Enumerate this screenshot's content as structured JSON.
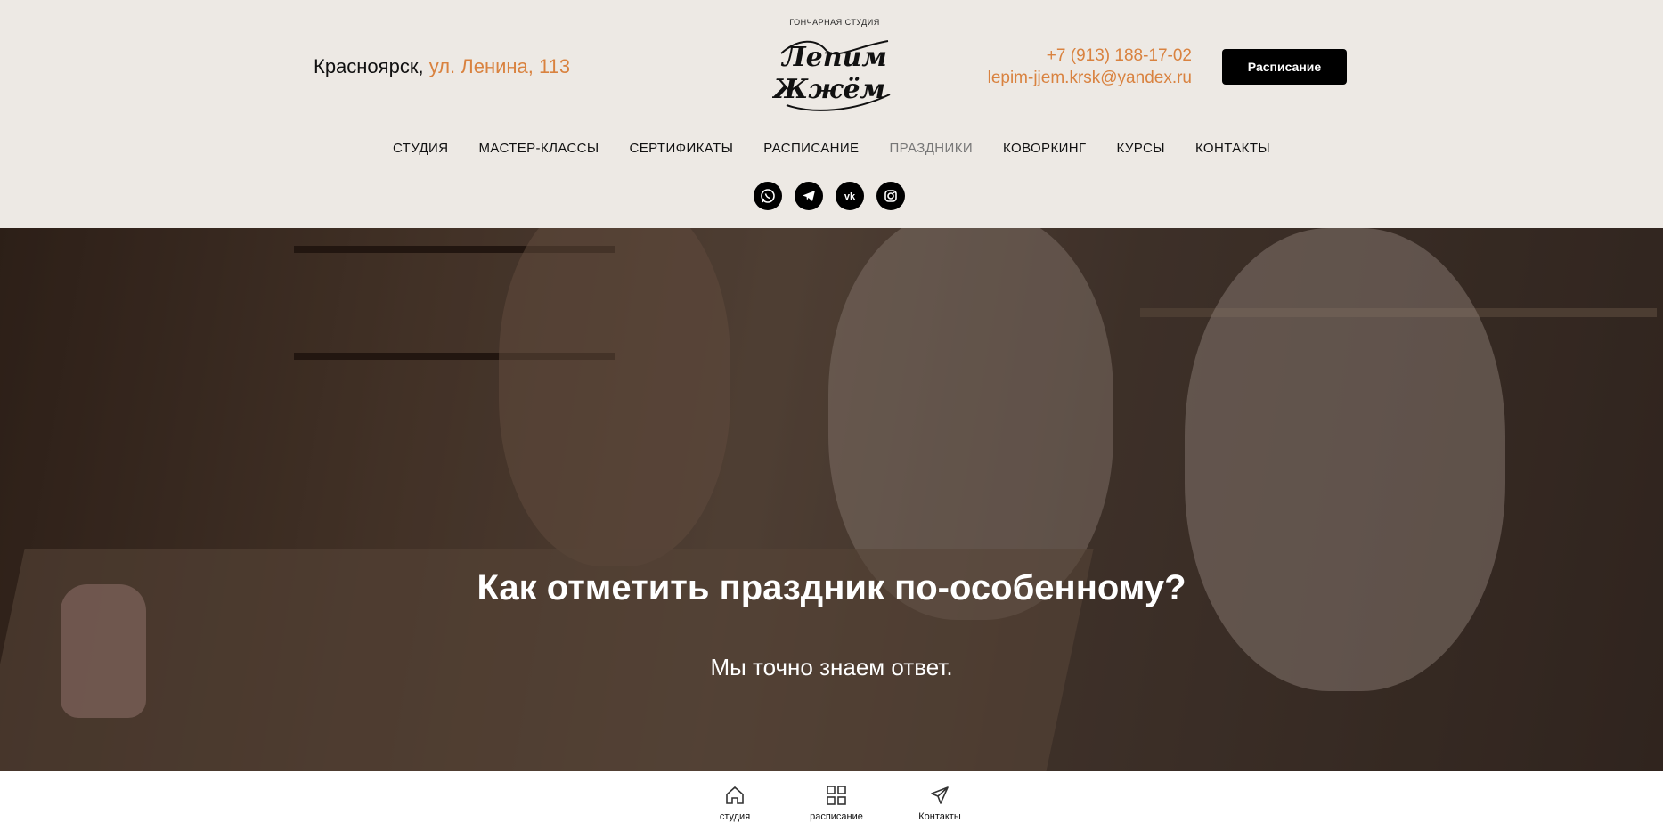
{
  "header": {
    "city": "Красноярск,",
    "street": "ул. Ленина, 113",
    "logo_top": "гончарная студия",
    "logo_name": "Лепим Жжём",
    "phone": "+7 (913) 188-17-02",
    "email": "lepim-jjem.krsk@yandex.ru",
    "schedule_button": "Расписание"
  },
  "nav": {
    "items": [
      {
        "label": "СТУДИЯ"
      },
      {
        "label": "МАСТЕР-КЛАССЫ"
      },
      {
        "label": "СЕРТИФИКАТЫ"
      },
      {
        "label": "РАСПИСАНИЕ"
      },
      {
        "label": "ПРАЗДНИКИ"
      },
      {
        "label": "КОВОРКИНГ"
      },
      {
        "label": "КУРСЫ"
      },
      {
        "label": "КОНТАКТЫ"
      }
    ],
    "active": "ПРАЗДНИКИ"
  },
  "socials": [
    "whatsapp-icon",
    "telegram-icon",
    "vk-icon",
    "instagram-icon"
  ],
  "hero": {
    "title": "Как отметить праздник по-особенному?",
    "subtitle": "Мы точно знаем ответ."
  },
  "bottom_bar": {
    "items": [
      {
        "label": "студия",
        "icon": "home-icon"
      },
      {
        "label": "расписание",
        "icon": "grid-icon"
      },
      {
        "label": "Контакты",
        "icon": "send-icon"
      }
    ]
  },
  "colors": {
    "accent": "#d9823f",
    "header_bg": "#ede9e4",
    "button_bg": "#000000"
  }
}
